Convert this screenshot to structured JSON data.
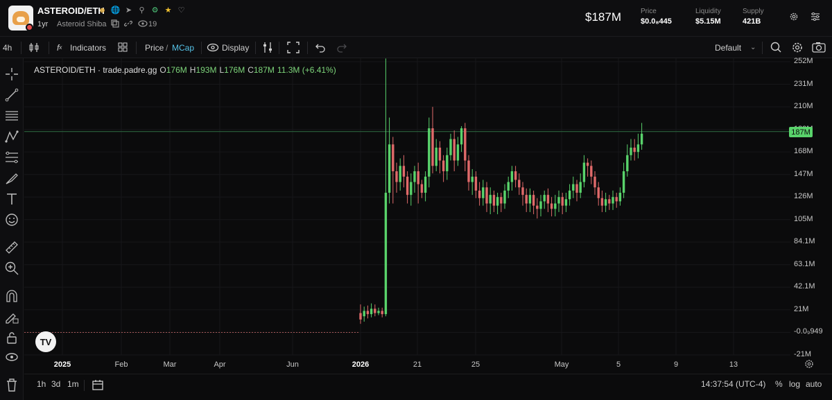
{
  "header": {
    "token_name": "ASTEROID/ETH",
    "age": "1yr",
    "full_name": "Asteroid Shiba",
    "views": "19",
    "market_cap": "$187M",
    "stats": [
      {
        "label": "Price",
        "value": "$0.0₈445"
      },
      {
        "label": "Liquidity",
        "value": "$5.15M"
      },
      {
        "label": "Supply",
        "value": "421B"
      }
    ],
    "icons": [
      "person-icon",
      "globe-icon",
      "telegram-icon",
      "search-icon",
      "scan-icon",
      "star-icon",
      "bell-icon"
    ]
  },
  "toolbar": {
    "interval": "4h",
    "indicators": "Indicators",
    "price": "Price",
    "slash": "/",
    "mcap": "MCap",
    "display": "Display",
    "template": "Default",
    "accent": "#56c3e8"
  },
  "legend": {
    "pair": "ASTEROID/ETH · trade.padre.gg",
    "o_key": "O",
    "o": "176M",
    "h_key": "H",
    "h": "193M",
    "l_key": "L",
    "l": "176M",
    "c_key": "C",
    "c": "187M",
    "change": "11.3M (+6.41%)"
  },
  "price_tag": "187M",
  "tv_logo": "TV",
  "bottom": {
    "ranges": [
      "1h",
      "3d",
      "1m"
    ],
    "time": "14:37:54 (UTC-4)",
    "pct": "%",
    "log": "log",
    "auto": "auto"
  },
  "colors": {
    "up": "#59d36b",
    "down": "#e06a6a",
    "background": "#0b0b0c"
  },
  "chart_data": {
    "type": "candlestick",
    "y_unit": "market cap",
    "ylim": [
      -21,
      252
    ],
    "y_ticks": [
      "252M",
      "231M",
      "210M",
      "189M",
      "168M",
      "147M",
      "126M",
      "105M",
      "84.1M",
      "63.1M",
      "42.1M",
      "21M",
      "-0.0₉949",
      "-21M"
    ],
    "x_ticks": [
      "2025",
      "Feb",
      "Mar",
      "Apr",
      "Jun",
      "2026",
      "21",
      "25",
      "May",
      "5",
      "9",
      "13"
    ],
    "bold_x_ticks": [
      "2025",
      "2026"
    ],
    "current": 187,
    "series": [
      {
        "name": "ASTEROID/ETH",
        "values": [
          0,
          0,
          0,
          0,
          0,
          0,
          0,
          0,
          0,
          0,
          0,
          0,
          0,
          0,
          0,
          0,
          0,
          0,
          0,
          0,
          0,
          0,
          0,
          0,
          0,
          0,
          0,
          0,
          0,
          0,
          0,
          0,
          0,
          0,
          0,
          0,
          0,
          0,
          0,
          0,
          0,
          0,
          0,
          0,
          0,
          0,
          0,
          0,
          0,
          0,
          0,
          0,
          0,
          0,
          0,
          0,
          0,
          0,
          0,
          0,
          0,
          0,
          0,
          0,
          0,
          0,
          0,
          0,
          0,
          0,
          0,
          0,
          0,
          0,
          0,
          0,
          0,
          0,
          0,
          0,
          0,
          0,
          0,
          0,
          0,
          0,
          0,
          0,
          0,
          0,
          0,
          0,
          0,
          0,
          0,
          0,
          0,
          0,
          0,
          0,
          0,
          0,
          0,
          0,
          0,
          0,
          0,
          0,
          0,
          0,
          0,
          0,
          0,
          0,
          0,
          0,
          0,
          0,
          0,
          0,
          0,
          0,
          0,
          0,
          0,
          0,
          0,
          0,
          0,
          0,
          0,
          0,
          0,
          0,
          0,
          0,
          0,
          0,
          0,
          0,
          0,
          0,
          0,
          0,
          0,
          0,
          0,
          0,
          0,
          0,
          0,
          0,
          0,
          0,
          0,
          0,
          0,
          0,
          0,
          0,
          0,
          0,
          0,
          0,
          0,
          0,
          0,
          0,
          0,
          0,
          0,
          0,
          0,
          0,
          0,
          0,
          0,
          0,
          0,
          0,
          0,
          0,
          0,
          0,
          0,
          0,
          0,
          0,
          0,
          0,
          0,
          0,
          0,
          0,
          0,
          0,
          0,
          0,
          0,
          0
        ]
      }
    ],
    "candles": [
      [
        18,
        12,
        26,
        8
      ],
      [
        15,
        20,
        24,
        10
      ],
      [
        20,
        17,
        25,
        13
      ],
      [
        17,
        22,
        27,
        14
      ],
      [
        22,
        18,
        26,
        15
      ],
      [
        18,
        20,
        23,
        16
      ],
      [
        20,
        17,
        23,
        14
      ],
      [
        17,
        130,
        255,
        15
      ],
      [
        130,
        175,
        200,
        120
      ],
      [
        175,
        150,
        182,
        120
      ],
      [
        150,
        140,
        158,
        130
      ],
      [
        140,
        155,
        162,
        132
      ],
      [
        155,
        145,
        165,
        135
      ],
      [
        145,
        128,
        150,
        120
      ],
      [
        128,
        140,
        148,
        118
      ],
      [
        140,
        150,
        155,
        130
      ],
      [
        150,
        138,
        158,
        120
      ],
      [
        138,
        130,
        142,
        125
      ],
      [
        130,
        145,
        150,
        122
      ],
      [
        145,
        190,
        200,
        135
      ],
      [
        190,
        155,
        210,
        148
      ],
      [
        155,
        172,
        180,
        150
      ],
      [
        172,
        160,
        178,
        148
      ],
      [
        160,
        150,
        165,
        140
      ],
      [
        150,
        165,
        172,
        142
      ],
      [
        165,
        180,
        185,
        160
      ],
      [
        180,
        160,
        188,
        150
      ],
      [
        160,
        175,
        182,
        155
      ],
      [
        175,
        190,
        192,
        168
      ],
      [
        190,
        160,
        195,
        150
      ],
      [
        160,
        140,
        165,
        132
      ],
      [
        140,
        145,
        152,
        128
      ],
      [
        145,
        132,
        150,
        125
      ],
      [
        132,
        125,
        140,
        118
      ],
      [
        125,
        135,
        142,
        118
      ],
      [
        135,
        120,
        140,
        112
      ],
      [
        120,
        128,
        135,
        110
      ],
      [
        128,
        118,
        132,
        112
      ],
      [
        118,
        126,
        130,
        110
      ],
      [
        126,
        120,
        130,
        112
      ],
      [
        120,
        132,
        138,
        115
      ],
      [
        132,
        140,
        145,
        125
      ],
      [
        140,
        150,
        155,
        132
      ],
      [
        150,
        142,
        155,
        135
      ],
      [
        142,
        135,
        148,
        128
      ],
      [
        135,
        128,
        140,
        118
      ],
      [
        128,
        120,
        134,
        112
      ],
      [
        120,
        128,
        134,
        112
      ],
      [
        128,
        118,
        132,
        110
      ],
      [
        118,
        115,
        125,
        106
      ],
      [
        115,
        122,
        128,
        108
      ],
      [
        122,
        128,
        132,
        115
      ],
      [
        128,
        120,
        134,
        112
      ],
      [
        120,
        115,
        126,
        108
      ],
      [
        115,
        120,
        128,
        108
      ],
      [
        120,
        126,
        132,
        112
      ],
      [
        126,
        118,
        130,
        110
      ],
      [
        118,
        124,
        130,
        112
      ],
      [
        124,
        132,
        138,
        118
      ],
      [
        132,
        138,
        145,
        125
      ],
      [
        138,
        130,
        142,
        122
      ],
      [
        130,
        140,
        148,
        125
      ],
      [
        140,
        158,
        165,
        135
      ],
      [
        158,
        155,
        162,
        145
      ],
      [
        155,
        145,
        160,
        138
      ],
      [
        145,
        135,
        150,
        128
      ],
      [
        135,
        125,
        140,
        118
      ],
      [
        125,
        118,
        132,
        112
      ],
      [
        118,
        124,
        130,
        112
      ],
      [
        124,
        120,
        128,
        114
      ],
      [
        120,
        126,
        132,
        114
      ],
      [
        126,
        122,
        130,
        116
      ],
      [
        122,
        130,
        135,
        118
      ],
      [
        130,
        150,
        158,
        125
      ],
      [
        150,
        165,
        175,
        145
      ],
      [
        165,
        172,
        180,
        160
      ],
      [
        172,
        168,
        180,
        160
      ],
      [
        168,
        175,
        185,
        162
      ],
      [
        175,
        185,
        195,
        170
      ]
    ]
  }
}
